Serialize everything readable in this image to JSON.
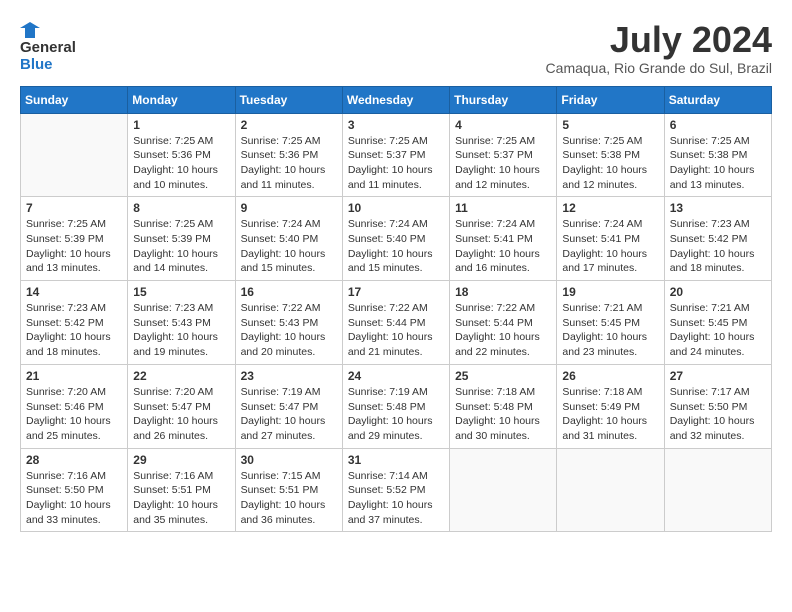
{
  "header": {
    "logo_general": "General",
    "logo_blue": "Blue",
    "month_title": "July 2024",
    "location": "Camaqua, Rio Grande do Sul, Brazil"
  },
  "calendar": {
    "days_of_week": [
      "Sunday",
      "Monday",
      "Tuesday",
      "Wednesday",
      "Thursday",
      "Friday",
      "Saturday"
    ],
    "weeks": [
      [
        {
          "day": "",
          "info": ""
        },
        {
          "day": "1",
          "info": "Sunrise: 7:25 AM\nSunset: 5:36 PM\nDaylight: 10 hours\nand 10 minutes."
        },
        {
          "day": "2",
          "info": "Sunrise: 7:25 AM\nSunset: 5:36 PM\nDaylight: 10 hours\nand 11 minutes."
        },
        {
          "day": "3",
          "info": "Sunrise: 7:25 AM\nSunset: 5:37 PM\nDaylight: 10 hours\nand 11 minutes."
        },
        {
          "day": "4",
          "info": "Sunrise: 7:25 AM\nSunset: 5:37 PM\nDaylight: 10 hours\nand 12 minutes."
        },
        {
          "day": "5",
          "info": "Sunrise: 7:25 AM\nSunset: 5:38 PM\nDaylight: 10 hours\nand 12 minutes."
        },
        {
          "day": "6",
          "info": "Sunrise: 7:25 AM\nSunset: 5:38 PM\nDaylight: 10 hours\nand 13 minutes."
        }
      ],
      [
        {
          "day": "7",
          "info": "Sunrise: 7:25 AM\nSunset: 5:39 PM\nDaylight: 10 hours\nand 13 minutes."
        },
        {
          "day": "8",
          "info": "Sunrise: 7:25 AM\nSunset: 5:39 PM\nDaylight: 10 hours\nand 14 minutes."
        },
        {
          "day": "9",
          "info": "Sunrise: 7:24 AM\nSunset: 5:40 PM\nDaylight: 10 hours\nand 15 minutes."
        },
        {
          "day": "10",
          "info": "Sunrise: 7:24 AM\nSunset: 5:40 PM\nDaylight: 10 hours\nand 15 minutes."
        },
        {
          "day": "11",
          "info": "Sunrise: 7:24 AM\nSunset: 5:41 PM\nDaylight: 10 hours\nand 16 minutes."
        },
        {
          "day": "12",
          "info": "Sunrise: 7:24 AM\nSunset: 5:41 PM\nDaylight: 10 hours\nand 17 minutes."
        },
        {
          "day": "13",
          "info": "Sunrise: 7:23 AM\nSunset: 5:42 PM\nDaylight: 10 hours\nand 18 minutes."
        }
      ],
      [
        {
          "day": "14",
          "info": "Sunrise: 7:23 AM\nSunset: 5:42 PM\nDaylight: 10 hours\nand 18 minutes."
        },
        {
          "day": "15",
          "info": "Sunrise: 7:23 AM\nSunset: 5:43 PM\nDaylight: 10 hours\nand 19 minutes."
        },
        {
          "day": "16",
          "info": "Sunrise: 7:22 AM\nSunset: 5:43 PM\nDaylight: 10 hours\nand 20 minutes."
        },
        {
          "day": "17",
          "info": "Sunrise: 7:22 AM\nSunset: 5:44 PM\nDaylight: 10 hours\nand 21 minutes."
        },
        {
          "day": "18",
          "info": "Sunrise: 7:22 AM\nSunset: 5:44 PM\nDaylight: 10 hours\nand 22 minutes."
        },
        {
          "day": "19",
          "info": "Sunrise: 7:21 AM\nSunset: 5:45 PM\nDaylight: 10 hours\nand 23 minutes."
        },
        {
          "day": "20",
          "info": "Sunrise: 7:21 AM\nSunset: 5:45 PM\nDaylight: 10 hours\nand 24 minutes."
        }
      ],
      [
        {
          "day": "21",
          "info": "Sunrise: 7:20 AM\nSunset: 5:46 PM\nDaylight: 10 hours\nand 25 minutes."
        },
        {
          "day": "22",
          "info": "Sunrise: 7:20 AM\nSunset: 5:47 PM\nDaylight: 10 hours\nand 26 minutes."
        },
        {
          "day": "23",
          "info": "Sunrise: 7:19 AM\nSunset: 5:47 PM\nDaylight: 10 hours\nand 27 minutes."
        },
        {
          "day": "24",
          "info": "Sunrise: 7:19 AM\nSunset: 5:48 PM\nDaylight: 10 hours\nand 29 minutes."
        },
        {
          "day": "25",
          "info": "Sunrise: 7:18 AM\nSunset: 5:48 PM\nDaylight: 10 hours\nand 30 minutes."
        },
        {
          "day": "26",
          "info": "Sunrise: 7:18 AM\nSunset: 5:49 PM\nDaylight: 10 hours\nand 31 minutes."
        },
        {
          "day": "27",
          "info": "Sunrise: 7:17 AM\nSunset: 5:50 PM\nDaylight: 10 hours\nand 32 minutes."
        }
      ],
      [
        {
          "day": "28",
          "info": "Sunrise: 7:16 AM\nSunset: 5:50 PM\nDaylight: 10 hours\nand 33 minutes."
        },
        {
          "day": "29",
          "info": "Sunrise: 7:16 AM\nSunset: 5:51 PM\nDaylight: 10 hours\nand 35 minutes."
        },
        {
          "day": "30",
          "info": "Sunrise: 7:15 AM\nSunset: 5:51 PM\nDaylight: 10 hours\nand 36 minutes."
        },
        {
          "day": "31",
          "info": "Sunrise: 7:14 AM\nSunset: 5:52 PM\nDaylight: 10 hours\nand 37 minutes."
        },
        {
          "day": "",
          "info": ""
        },
        {
          "day": "",
          "info": ""
        },
        {
          "day": "",
          "info": ""
        }
      ]
    ]
  }
}
